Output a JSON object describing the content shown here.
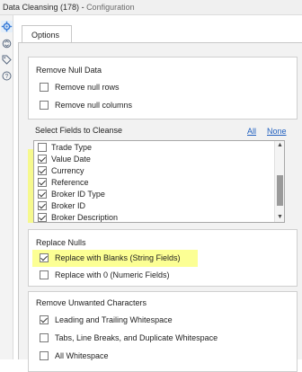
{
  "title": {
    "tool": "Data Cleansing (178)",
    "separator": " - ",
    "section": "Configuration"
  },
  "rail_icons": [
    "gear-icon",
    "sync-icon",
    "tag-icon",
    "help-icon"
  ],
  "tab": {
    "label": "Options"
  },
  "remove_null": {
    "title": "Remove Null Data",
    "rows": {
      "label": "Remove null rows",
      "checked": false
    },
    "columns": {
      "label": "Remove null columns",
      "checked": false
    }
  },
  "fields": {
    "title": "Select Fields to Cleanse",
    "all_label": "All",
    "none_label": "None",
    "items": [
      {
        "label": "Trade Type",
        "checked": false
      },
      {
        "label": "Value Date",
        "checked": true
      },
      {
        "label": "Currency",
        "checked": true
      },
      {
        "label": "Reference",
        "checked": true
      },
      {
        "label": "Broker ID Type",
        "checked": true
      },
      {
        "label": "Broker ID",
        "checked": true
      },
      {
        "label": "Broker Description",
        "checked": true
      }
    ]
  },
  "replace_nulls": {
    "title": "Replace Nulls",
    "blanks": {
      "label": "Replace with Blanks (String Fields)",
      "checked": true
    },
    "zero": {
      "label": "Replace with 0 (Numeric Fields)",
      "checked": false
    }
  },
  "unwanted": {
    "title": "Remove Unwanted Characters",
    "leading": {
      "label": "Leading and Trailing Whitespace",
      "checked": true
    },
    "tabs": {
      "label": "Tabs, Line Breaks, and Duplicate Whitespace",
      "checked": false
    },
    "all_ws": {
      "label": "All Whitespace",
      "checked": false
    }
  },
  "colors": {
    "highlight": "#faff3c",
    "link": "#1f5fbf"
  }
}
